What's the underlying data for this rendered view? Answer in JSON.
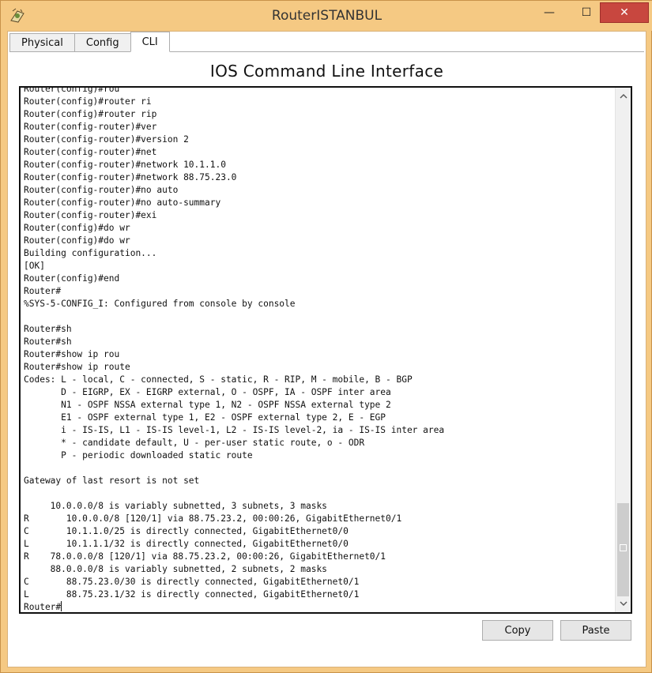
{
  "window": {
    "title": "RouterISTANBUL",
    "minimize_glyph": "—",
    "maximize_glyph": "☐",
    "close_glyph": "✕"
  },
  "tabs": [
    {
      "label": "Physical",
      "active": false
    },
    {
      "label": "Config",
      "active": false
    },
    {
      "label": "CLI",
      "active": true
    }
  ],
  "panel": {
    "heading": "IOS Command Line Interface"
  },
  "terminal": {
    "lines": [
      "Router(config)#rou",
      "Router(config)#router ri",
      "Router(config)#router rip",
      "Router(config-router)#ver",
      "Router(config-router)#version 2",
      "Router(config-router)#net",
      "Router(config-router)#network 10.1.1.0",
      "Router(config-router)#network 88.75.23.0",
      "Router(config-router)#no auto",
      "Router(config-router)#no auto-summary",
      "Router(config-router)#exi",
      "Router(config)#do wr",
      "Router(config)#do wr",
      "Building configuration...",
      "[OK]",
      "Router(config)#end",
      "Router#",
      "%SYS-5-CONFIG_I: Configured from console by console",
      "",
      "Router#sh",
      "Router#sh",
      "Router#show ip rou",
      "Router#show ip route",
      "Codes: L - local, C - connected, S - static, R - RIP, M - mobile, B - BGP",
      "       D - EIGRP, EX - EIGRP external, O - OSPF, IA - OSPF inter area",
      "       N1 - OSPF NSSA external type 1, N2 - OSPF NSSA external type 2",
      "       E1 - OSPF external type 1, E2 - OSPF external type 2, E - EGP",
      "       i - IS-IS, L1 - IS-IS level-1, L2 - IS-IS level-2, ia - IS-IS inter area",
      "       * - candidate default, U - per-user static route, o - ODR",
      "       P - periodic downloaded static route",
      "",
      "Gateway of last resort is not set",
      "",
      "     10.0.0.0/8 is variably subnetted, 3 subnets, 3 masks",
      "R       10.0.0.0/8 [120/1] via 88.75.23.2, 00:00:26, GigabitEthernet0/1",
      "C       10.1.1.0/25 is directly connected, GigabitEthernet0/0",
      "L       10.1.1.1/32 is directly connected, GigabitEthernet0/0",
      "R    78.0.0.0/8 [120/1] via 88.75.23.2, 00:00:26, GigabitEthernet0/1",
      "     88.0.0.0/8 is variably subnetted, 2 subnets, 2 masks",
      "C       88.75.23.0/30 is directly connected, GigabitEthernet0/1",
      "L       88.75.23.1/32 is directly connected, GigabitEthernet0/1"
    ],
    "prompt": "Router#"
  },
  "actions": {
    "copy_label": "Copy",
    "paste_label": "Paste"
  },
  "icons": {
    "app": "packet-tracer-router-icon",
    "scroll_up": "chevron-up-icon",
    "scroll_down": "chevron-down-icon"
  },
  "colors": {
    "frame": "#f5c983",
    "close": "#c8473f"
  }
}
